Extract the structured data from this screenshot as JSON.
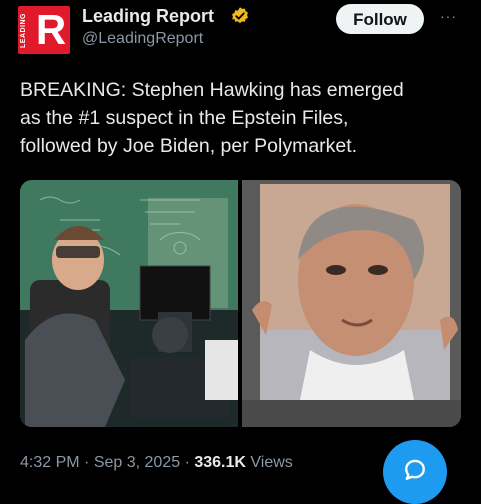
{
  "account": {
    "avatar_letter": "R",
    "avatar_side_text": "LEADING",
    "name": "Leading Report",
    "handle": "@LeadingReport",
    "verified_badge_color": "#f2b81f",
    "brand_color": "#e0192b"
  },
  "actions": {
    "follow_label": "Follow",
    "more_label": "···"
  },
  "tweet": {
    "text": "BREAKING: Stephen Hawking has emerged\nas the #1 suspect in the Epstein Files,\nfollowed by Joe Biden, per Polymarket."
  },
  "media": {
    "images": [
      {
        "name": "stephen-hawking-photo"
      },
      {
        "name": "jeffrey-epstein-photo"
      }
    ]
  },
  "meta": {
    "time": "4:32 PM",
    "separator": "·",
    "date": "Sep 3, 2025",
    "views_count": "336.1K",
    "views_label": "Views"
  },
  "fab": {
    "icon": "reply-icon",
    "color": "#1d9bf0"
  }
}
